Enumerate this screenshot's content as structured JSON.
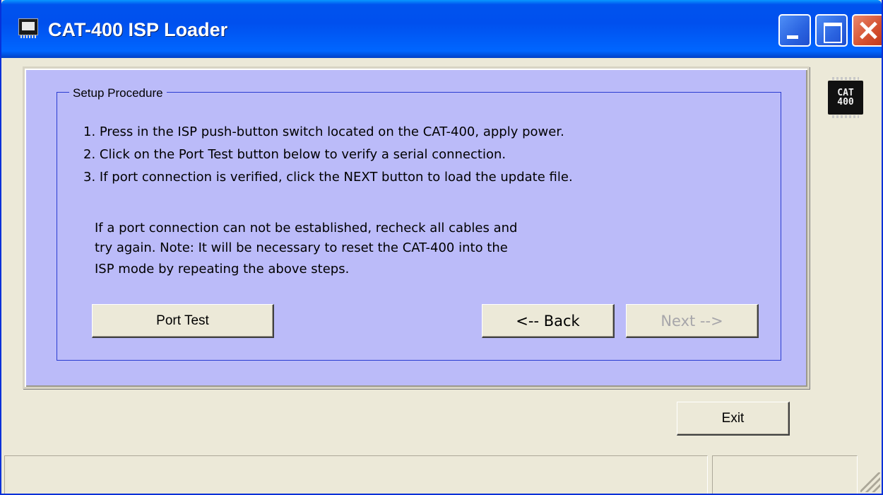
{
  "window": {
    "title": "CAT-400 ISP Loader",
    "icon": "chip-icon",
    "controls": [
      "minimize",
      "maximize",
      "close"
    ]
  },
  "setup": {
    "group_title": "Setup Procedure",
    "steps": [
      "1. Press in the ISP push-button switch located on the CAT-400, apply power.",
      "2. Click on the Port Test button below to verify a serial connection.",
      "3. If port connection is verified, click the NEXT button to load the update file."
    ],
    "note_lines": [
      "If a port connection can not be established, recheck all cables and",
      "try again.   Note: It will be necessary to reset the CAT-400 into the",
      "ISP mode by repeating the above steps."
    ]
  },
  "buttons": {
    "port_test": "Port Test",
    "back": "<-- Back",
    "next": "Next -->",
    "exit": "Exit"
  },
  "logo": {
    "line1": "CAT",
    "line2": "400"
  },
  "colors": {
    "panel_bg": "#bbbbf9",
    "title_bar": "#0053ee",
    "disabled_text": "#a7a6aa"
  },
  "status": {
    "left": "",
    "right": ""
  }
}
